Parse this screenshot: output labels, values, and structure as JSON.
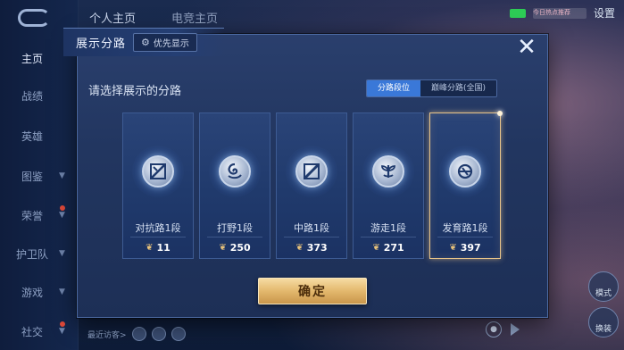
{
  "sidebar": {
    "items": [
      {
        "label": "主页",
        "active": true,
        "chevron": false,
        "dot": false
      },
      {
        "label": "战绩",
        "active": false,
        "chevron": false,
        "dot": false
      },
      {
        "label": "英雄",
        "active": false,
        "chevron": false,
        "dot": false
      },
      {
        "label": "图鉴",
        "active": false,
        "chevron": true,
        "dot": false
      },
      {
        "label": "荣誉",
        "active": false,
        "chevron": true,
        "dot": true
      },
      {
        "label": "护卫队",
        "active": false,
        "chevron": true,
        "dot": false
      },
      {
        "label": "游戏",
        "active": false,
        "chevron": true,
        "dot": false
      },
      {
        "label": "社交",
        "active": false,
        "chevron": true,
        "dot": true
      }
    ]
  },
  "top_tabs": [
    "个人主页",
    "电竞主页"
  ],
  "top_right": {
    "notice_text": "今日热点推荐",
    "settings_label": "设置"
  },
  "bottom_left": {
    "recent_visitors_label": "最近访客>"
  },
  "right_controls": {
    "story_label": "模式",
    "replace_label": "换装"
  },
  "modal": {
    "title": "展示分路",
    "priority_label": "优先显示",
    "close_symbol": "✕",
    "prompt": "请选择展示的分路",
    "toggle": {
      "left": "分路段位",
      "right": "巅峰分路(全国)",
      "active": "left"
    },
    "cards": [
      {
        "label": "对抗路1段",
        "count": "11",
        "icon": "clash-lane-icon",
        "selected": false
      },
      {
        "label": "打野1段",
        "count": "250",
        "icon": "jungle-icon",
        "selected": false
      },
      {
        "label": "中路1段",
        "count": "373",
        "icon": "mid-lane-icon",
        "selected": false
      },
      {
        "label": "游走1段",
        "count": "271",
        "icon": "roam-icon",
        "selected": false
      },
      {
        "label": "发育路1段",
        "count": "397",
        "icon": "farm-lane-icon",
        "selected": true
      }
    ],
    "confirm_label": "确定"
  },
  "colors": {
    "accent_toggle": "#3a78d8",
    "confirm_gold": "#e3b86d",
    "selected_border": "#e8c48a"
  }
}
